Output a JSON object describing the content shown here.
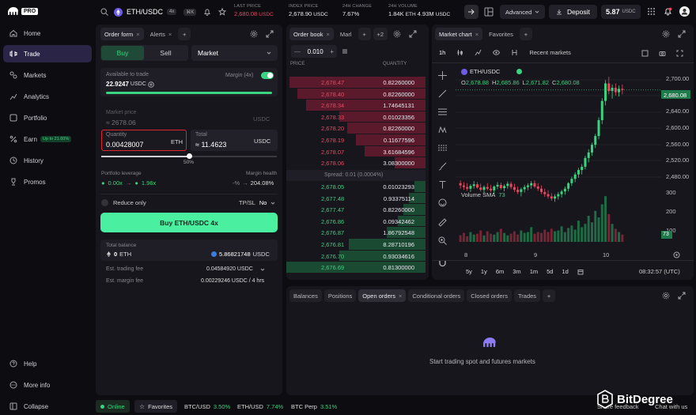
{
  "sidebar": {
    "logo": "PRO",
    "items": [
      {
        "label": "Home"
      },
      {
        "label": "Trade"
      },
      {
        "label": "Markets"
      },
      {
        "label": "Analytics"
      },
      {
        "label": "Portfolio"
      },
      {
        "label": "Earn",
        "badge": "Up to 21.60%"
      },
      {
        "label": "History"
      },
      {
        "label": "Promos"
      }
    ],
    "bottom": [
      {
        "label": "Help"
      },
      {
        "label": "More info"
      },
      {
        "label": "Collapse"
      }
    ]
  },
  "topbar": {
    "pair": "ETH/USDC",
    "leverage_badge": "4x",
    "shortcut_badge": "⌘K",
    "last_price_label": "LAST PRICE",
    "last_price": "2,680.08",
    "last_price_unit": "USDC",
    "index_price_label": "INDEX PRICE",
    "index_price": "2,678.90",
    "index_price_unit": "USDC",
    "change_label": "24H CHANGE",
    "change": "7.67%",
    "volume_label": "24H VOLUME",
    "volume": "1.84K",
    "volume_unit": "ETH",
    "volume2": "4.93M",
    "volume2_unit": "USDC",
    "advanced_label": "Advanced",
    "deposit_label": "Deposit",
    "balance": "5.87",
    "balance_unit": "USDC"
  },
  "order_form": {
    "tabs": [
      "Order form",
      "Alerts"
    ],
    "buy_label": "Buy",
    "sell_label": "Sell",
    "order_type": "Market",
    "available_label": "Available to trade",
    "available_value": "22.9247",
    "available_unit": "USDC",
    "margin_label": "Margin (4x)",
    "market_price_label": "Market price",
    "market_price_value": "2678.06",
    "market_price_unit": "USDC",
    "quantity_label": "Quantity",
    "quantity_value": "0.00428007",
    "quantity_unit": "ETH",
    "total_label": "Total",
    "total_value": "11.4623",
    "total_approx": "≈",
    "total_unit": "USDC",
    "slider_percent": "50%",
    "slider_fraction": 0.5,
    "portfolio_leverage_label": "Portfolio leverage",
    "leverage_from": "0.00x",
    "leverage_to": "1.96x",
    "margin_health_label": "Margin health",
    "health_from": "-%",
    "health_to": "204.08%",
    "reduce_only_label": "Reduce only",
    "tpsl_label": "TP/SL",
    "tpsl_value": "No",
    "submit_label": "Buy ETH/USDC 4x",
    "total_balance_label": "Total balance",
    "total_balance_eth": "0",
    "total_balance_eth_unit": "ETH",
    "total_balance_usdc": "5.86821748",
    "total_balance_usdc_unit": "USDC",
    "trading_fee_label": "Est. trading fee",
    "trading_fee_value": "0.04584920 USDC",
    "margin_fee_label": "Est. margin fee",
    "margin_fee_value": "0.00229246 USDC / 4 hrs"
  },
  "order_book": {
    "tabs": [
      "Order book",
      "Marl"
    ],
    "more_tabs": "+2",
    "tick_size": "0.010",
    "price_header": "PRICE",
    "quantity_header": "QUANTITY",
    "asks": [
      {
        "price": "2,678.47",
        "qty": "0.82260000",
        "depth": 0.98
      },
      {
        "price": "2,678.40",
        "qty": "0.82260000",
        "depth": 0.92
      },
      {
        "price": "2,678.34",
        "qty": "1.74645131",
        "depth": 0.86
      },
      {
        "price": "2,678.33",
        "qty": "0.01023356",
        "depth": 0.62
      },
      {
        "price": "2,678.20",
        "qty": "0.82260000",
        "depth": 0.56
      },
      {
        "price": "2,678.19",
        "qty": "0.11677596",
        "depth": 0.5
      },
      {
        "price": "2,678.07",
        "qty": "3.61684596",
        "depth": 0.44
      },
      {
        "price": "2,678.06",
        "qty": "3.08300000",
        "depth": 0.22
      }
    ],
    "spread_label": "Spread: 0.01 (0.0004%)",
    "bids": [
      {
        "price": "2,678.05",
        "qty": "0.01023293",
        "depth": 0.08
      },
      {
        "price": "2,677.48",
        "qty": "0.93375114",
        "depth": 0.12
      },
      {
        "price": "2,677.47",
        "qty": "0.82260000",
        "depth": 0.16
      },
      {
        "price": "2,676.86",
        "qty": "0.09342462",
        "depth": 0.2
      },
      {
        "price": "2,676.87",
        "qty": "1.86792548",
        "depth": 0.28
      },
      {
        "price": "2,676.81",
        "qty": "8.28710196",
        "depth": 0.55
      },
      {
        "price": "2,676.70",
        "qty": "0.93034616",
        "depth": 0.62
      },
      {
        "price": "2,676.69",
        "qty": "0.81300000",
        "depth": 1.0
      }
    ]
  },
  "chart": {
    "tabs": [
      "Market chart",
      "Favorites"
    ],
    "interval": "1h",
    "recent_markets_label": "Recent markets",
    "symbol": "ETH/USDC",
    "ohlc": {
      "o": "2,678.88",
      "h": "2,685.86",
      "l": "2,671.82",
      "c": "2,680.08"
    },
    "ohlc_prefix": {
      "o": "O",
      "h": "H",
      "l": "L",
      "c": "C"
    },
    "volume_label": "Volume SMA",
    "volume_sma": "73",
    "volume_badge": "73",
    "price_badge": "2,680.08",
    "timeframes": [
      "5y",
      "1y",
      "6m",
      "3m",
      "1m",
      "5d",
      "1d"
    ],
    "clock": "08:32:57 (UTC)"
  },
  "chart_data": {
    "type": "candlestick",
    "price_ticks": [
      "2,700.00",
      "2,680.00",
      "2,640.00",
      "2,600.00",
      "2,560.00",
      "2,520.00",
      "2,480.00"
    ],
    "volume_ticks": [
      "300",
      "200",
      "100"
    ],
    "x_ticks": [
      "8",
      "9",
      "10"
    ],
    "ylim": [
      2465,
      2710
    ],
    "candles": [
      [
        2510,
        2515,
        2500,
        2506
      ],
      [
        2506,
        2512,
        2498,
        2503
      ],
      [
        2503,
        2510,
        2496,
        2500
      ],
      [
        2500,
        2508,
        2494,
        2505
      ],
      [
        2505,
        2514,
        2500,
        2508
      ],
      [
        2508,
        2512,
        2500,
        2502
      ],
      [
        2502,
        2509,
        2495,
        2498
      ],
      [
        2498,
        2506,
        2492,
        2503
      ],
      [
        2503,
        2510,
        2497,
        2500
      ],
      [
        2500,
        2507,
        2494,
        2497
      ],
      [
        2497,
        2506,
        2490,
        2504
      ],
      [
        2504,
        2512,
        2499,
        2507
      ],
      [
        2507,
        2511,
        2498,
        2501
      ],
      [
        2501,
        2508,
        2495,
        2505
      ],
      [
        2505,
        2513,
        2500,
        2509
      ],
      [
        2509,
        2513,
        2499,
        2503
      ],
      [
        2503,
        2509,
        2494,
        2498
      ],
      [
        2498,
        2504,
        2490,
        2494
      ],
      [
        2494,
        2502,
        2486,
        2499
      ],
      [
        2499,
        2507,
        2493,
        2503
      ],
      [
        2503,
        2510,
        2497,
        2506
      ],
      [
        2506,
        2514,
        2500,
        2510
      ],
      [
        2510,
        2515,
        2501,
        2504
      ],
      [
        2504,
        2510,
        2496,
        2500
      ],
      [
        2500,
        2506,
        2490,
        2494
      ],
      [
        2494,
        2500,
        2485,
        2490
      ],
      [
        2490,
        2497,
        2482,
        2486
      ],
      [
        2486,
        2492,
        2478,
        2482
      ],
      [
        2482,
        2490,
        2476,
        2486
      ],
      [
        2486,
        2494,
        2480,
        2490
      ],
      [
        2490,
        2498,
        2484,
        2495
      ],
      [
        2495,
        2504,
        2489,
        2500
      ],
      [
        2500,
        2512,
        2495,
        2510
      ],
      [
        2510,
        2522,
        2505,
        2518
      ],
      [
        2518,
        2530,
        2512,
        2526
      ],
      [
        2526,
        2538,
        2520,
        2534
      ],
      [
        2534,
        2545,
        2526,
        2540
      ],
      [
        2540,
        2560,
        2535,
        2556
      ],
      [
        2556,
        2572,
        2548,
        2566
      ],
      [
        2566,
        2584,
        2560,
        2580
      ],
      [
        2580,
        2600,
        2574,
        2596
      ],
      [
        2596,
        2630,
        2590,
        2625
      ],
      [
        2625,
        2665,
        2618,
        2660
      ],
      [
        2660,
        2698,
        2652,
        2692
      ],
      [
        2692,
        2704,
        2672,
        2678
      ],
      [
        2678,
        2690,
        2664,
        2684
      ],
      [
        2684,
        2692,
        2670,
        2676
      ],
      [
        2676,
        2688,
        2668,
        2682
      ],
      [
        2682,
        2690,
        2672,
        2680
      ]
    ],
    "volumes": [
      40,
      55,
      35,
      60,
      45,
      50,
      70,
      40,
      65,
      50,
      45,
      60,
      80,
      55,
      40,
      50,
      65,
      45,
      70,
      55,
      60,
      90,
      50,
      60,
      55,
      75,
      60,
      80,
      65,
      70,
      95,
      60,
      85,
      100,
      75,
      130,
      90,
      110,
      160,
      120,
      190,
      150,
      230,
      280,
      170,
      110,
      80,
      60,
      45
    ]
  },
  "bottom_panel": {
    "tabs": [
      "Balances",
      "Positions",
      "Open orders",
      "Conditional orders",
      "Closed orders",
      "Trades"
    ],
    "empty_text": "Start trading spot and futures markets"
  },
  "statusbar": {
    "online": "Online",
    "favorites": "Favorites",
    "tickers": [
      {
        "pair": "BTC/USD",
        "change": "3.50%"
      },
      {
        "pair": "ETH/USD",
        "change": "7.74%"
      },
      {
        "pair": "BTC Perp",
        "change": "3.51%"
      }
    ],
    "share_feedback": "Share feedback",
    "chat": "Chat with us"
  },
  "watermark": "BitDegree",
  "colors": {
    "accent": "#7b61ff",
    "green": "#3ad37f",
    "buy_button": "#4af0a0",
    "red": "#f0455e",
    "highlight": "#e0242f"
  }
}
